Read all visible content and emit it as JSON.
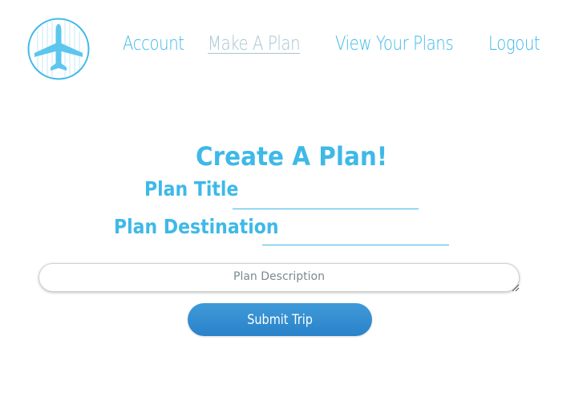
{
  "header": {
    "logo_icon": "airplane-icon",
    "nav": [
      {
        "label": "Account",
        "active": false
      },
      {
        "label": "Make A Plan",
        "active": true
      },
      {
        "label": "View Your Plans",
        "active": false
      },
      {
        "label": "Logout",
        "active": false
      }
    ]
  },
  "form": {
    "title": "Create A Plan!",
    "plan_title_label": "Plan Title",
    "plan_title_value": "",
    "plan_destination_label": "Plan Destination",
    "plan_destination_value": "",
    "description_placeholder": "Plan Description",
    "description_value": "",
    "submit_label": "Submit Trip"
  },
  "colors": {
    "accent": "#3eb9e8",
    "nav_active": "#a6c4d1",
    "button": "#2f8dd0",
    "button_text": "#ffffff"
  }
}
